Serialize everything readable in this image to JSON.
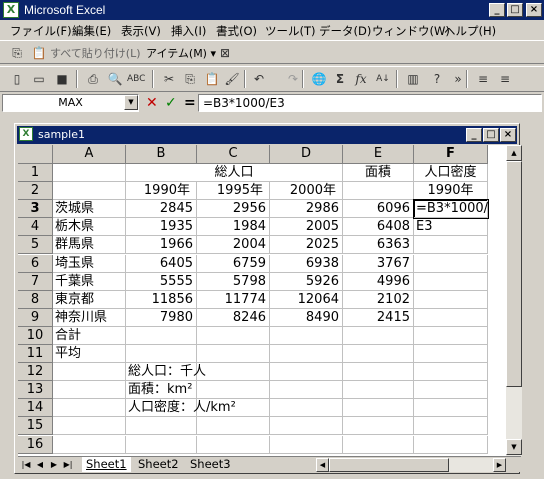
{
  "app": {
    "title": "Microsoft Excel",
    "icon_label": "X"
  },
  "window_controls": {
    "minimize": "_",
    "maximize": "□",
    "close": "×"
  },
  "menu": [
    "ファイル(F)",
    "編集(E)",
    "表示(V)",
    "挿入(I)",
    "書式(O)",
    "ツール(T)",
    "データ(D)",
    "ウィンドウ(W)",
    "ヘルプ(H)"
  ],
  "toolbar1": {
    "paste_values": "すべて貼り付け(L)",
    "items": "アイテム(M) ▾"
  },
  "formula_bar": {
    "name_box": "MAX",
    "cancel": "✕",
    "enter": "✓",
    "equals": "=",
    "formula": "=B3*1000/E3"
  },
  "document": {
    "title": "sample1"
  },
  "columns": [
    "A",
    "B",
    "C",
    "D",
    "E",
    "F"
  ],
  "rows": [
    "1",
    "2",
    "3",
    "4",
    "5",
    "6",
    "7",
    "8",
    "9",
    "10",
    "11",
    "12",
    "13",
    "14",
    "15",
    "16"
  ],
  "cells": {
    "C1": "総人口",
    "E1": "面積",
    "F1": "人口密度",
    "B2": "1990年",
    "C2": "1995年",
    "D2": "2000年",
    "F2": "1990年",
    "A3": "茨城県",
    "B3": "2845",
    "C3": "2956",
    "D3": "2986",
    "E3": "6096",
    "F3": "=B3*1000/",
    "A4": "栃木県",
    "B4": "1935",
    "C4": "1984",
    "D4": "2005",
    "E4": "6408",
    "F4": "E3",
    "A5": "群馬県",
    "B5": "1966",
    "C5": "2004",
    "D5": "2025",
    "E5": "6363",
    "A6": "埼玉県",
    "B6": "6405",
    "C6": "6759",
    "D6": "6938",
    "E6": "3767",
    "A7": "千葉県",
    "B7": "5555",
    "C7": "5798",
    "D7": "5926",
    "E7": "4996",
    "A8": "東京都",
    "B8": "11856",
    "C8": "11774",
    "D8": "12064",
    "E8": "2102",
    "A9": "神奈川県",
    "B9": "7980",
    "C9": "8246",
    "D9": "8490",
    "E9": "2415",
    "A10": "合計",
    "A11": "平均",
    "B12": "総人口：千人",
    "B13": "面積：km²",
    "B14": "人口密度：人/km²"
  },
  "sheets": [
    "Sheet1",
    "Sheet2",
    "Sheet3"
  ],
  "active_sheet": "Sheet1",
  "active_cell": "F3"
}
